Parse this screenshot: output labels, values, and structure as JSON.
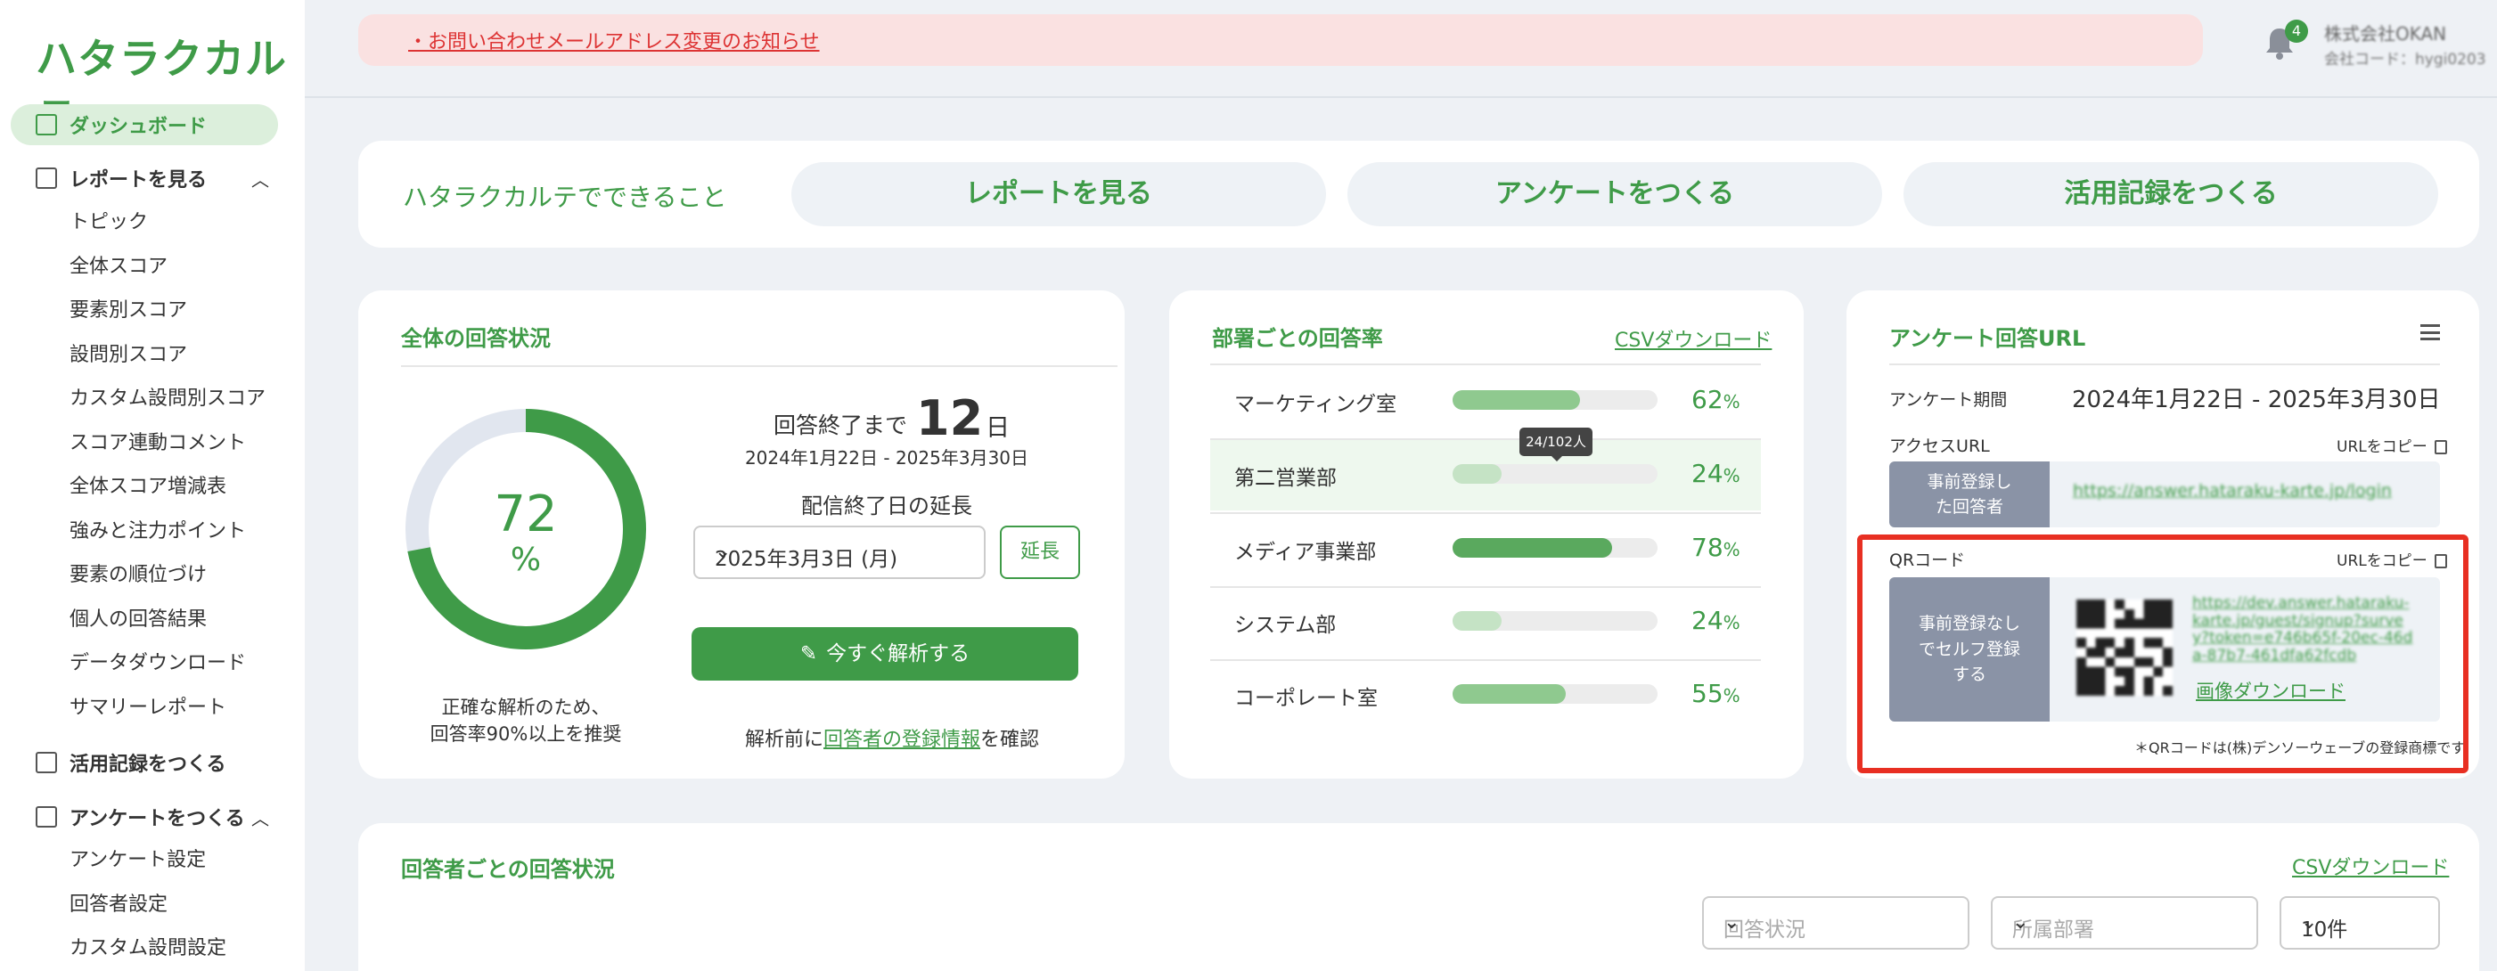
{
  "brand": {
    "logo_text": "ハタラクカルテ",
    "accent": "#3f9b48"
  },
  "sidebar": {
    "dashboard": "ダッシュボード",
    "reports": {
      "label": "レポートを見る",
      "items": [
        "トピック",
        "全体スコア",
        "要素別スコア",
        "設問別スコア",
        "カスタム設問別スコア",
        "スコア連動コメント",
        "全体スコア増減表",
        "強みと注力ポイント",
        "要素の順位づけ",
        "個人の回答結果",
        "データダウンロード",
        "サマリーレポート"
      ]
    },
    "records": "活用記録をつくる",
    "surveys": {
      "label": "アンケートをつくる",
      "items": [
        "アンケート設定",
        "回答者設定",
        "カスタム設問設定"
      ]
    }
  },
  "header": {
    "notice": "・お問い合わせメールアドレス変更のお知らせ",
    "notification_count": "4",
    "company": "株式会社OKAN",
    "company_code": "会社コード：hygi0203"
  },
  "features": {
    "label": "ハタラクカルテでできること",
    "buttons": [
      "レポートを見る",
      "アンケートをつくる",
      "活用記録をつくる"
    ]
  },
  "overall": {
    "title": "全体の回答状況",
    "rate": "72",
    "rate_unit": "%",
    "rate_value": 72,
    "note_line1": "正確な解析のため、",
    "note_line2": "回答率90%以上を推奨",
    "days_label": "回答終了まで",
    "days": "12",
    "days_unit": "日",
    "period": "2024年1月22日 - 2025年3月30日",
    "extend_label": "配信終了日の延長",
    "extend_date": "2025年3月3日 (月)",
    "extend_button": "延長",
    "analyze_button": "今すぐ解析する",
    "confirm_prefix": "解析前に",
    "confirm_link": "回答者の登録情報",
    "confirm_suffix": "を確認"
  },
  "departments": {
    "title": "部署ごとの回答率",
    "csv": "CSVダウンロード",
    "tooltip": "24/102人",
    "rows": [
      {
        "name": "マーケティング室",
        "pct": "62",
        "value": 62,
        "color": "#8fc98f"
      },
      {
        "name": "第二営業部",
        "pct": "24",
        "value": 24,
        "color": "#c5e3c5"
      },
      {
        "name": "メディア事業部",
        "pct": "78",
        "value": 78,
        "color": "#5aa95e"
      },
      {
        "name": "システム部",
        "pct": "24",
        "value": 24,
        "color": "#c5e3c5"
      },
      {
        "name": "コーポレート室",
        "pct": "55",
        "value": 55,
        "color": "#8fc98f"
      }
    ],
    "pct_unit": "%"
  },
  "survey_url": {
    "title": "アンケート回答URL",
    "period_label": "アンケート期間",
    "period": "2024年1月22日 - 2025年3月30日",
    "access_label": "アクセスURL",
    "copy_label": "URLをコピー",
    "registered_label": "事前登録した回答者",
    "registered_url": "https://answer.hataraku-karte.jp/login",
    "qr_label": "QRコード",
    "self_label": "事前登録なしでセルフ登録する",
    "self_url": "https://dev.answer.hataraku-karte.jp/guest/signup?survey?token=e746b65f-20ec-46da-87b7-461dfa62fcdb",
    "image_download": "画像ダウンロード",
    "footnote": "＊QRコードは(株)デンソーウェーブの登録商標です"
  },
  "respondents": {
    "title": "回答者ごとの回答状況",
    "csv": "CSVダウンロード",
    "filters": [
      "回答状況",
      "所属部署",
      "10件"
    ]
  }
}
